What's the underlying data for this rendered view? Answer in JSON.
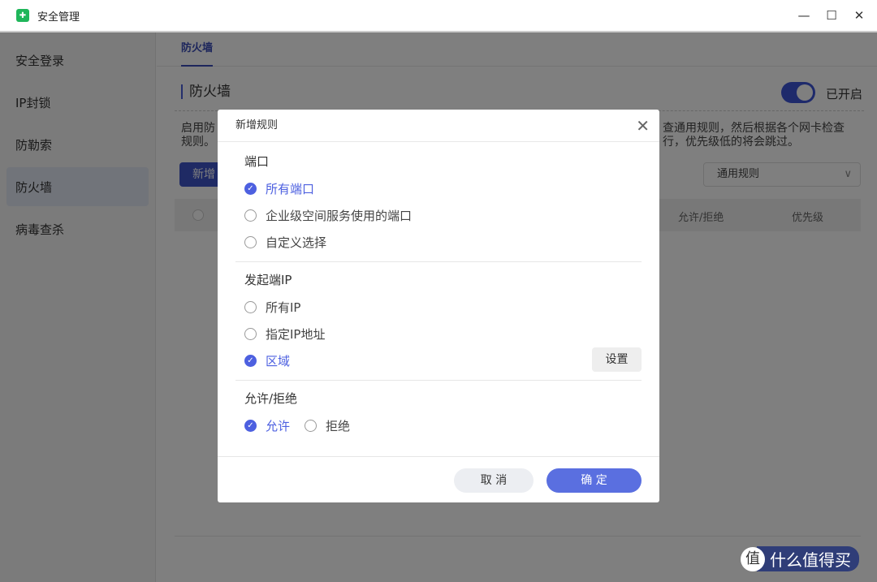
{
  "window": {
    "title": "安全管理",
    "controls": [
      "—",
      "☐",
      "✕"
    ]
  },
  "sidebar": {
    "items": [
      {
        "label": "安全登录"
      },
      {
        "label": "IP封锁"
      },
      {
        "label": "防勒索"
      },
      {
        "label": "防火墙",
        "active": true
      },
      {
        "label": "病毒查杀"
      }
    ]
  },
  "main": {
    "tab": "防火墙",
    "section_title": "防火墙",
    "toggle_label": "已开启",
    "toggle_on": true,
    "desc_left_1": "启用防",
    "desc_left_2": "规则。",
    "desc_right_1": "查通用规则，然后根据各个网卡检查",
    "desc_right_2": "行，优先级低的将会跳过。",
    "add_button": "新增",
    "select_value": "通用规则",
    "columns": [
      "允许/拒绝",
      "优先级"
    ]
  },
  "dialog": {
    "title": "新增规则",
    "port": {
      "title": "端口",
      "options": [
        "所有端口",
        "企业级空间服务使用的端口",
        "自定义选择"
      ],
      "selected": 0
    },
    "source_ip": {
      "title": "发起端IP",
      "options": [
        "所有IP",
        "指定IP地址",
        "区域"
      ],
      "selected": 2,
      "settings_button": "设置"
    },
    "action": {
      "title": "允许/拒绝",
      "options": [
        "允许",
        "拒绝"
      ],
      "selected": 0
    },
    "cancel": "取 消",
    "confirm": "确 定"
  },
  "watermark": {
    "icon": "值",
    "text": "什么值得买"
  },
  "colors": {
    "accent": "#4d60e0",
    "logo": "#1fb65a"
  }
}
